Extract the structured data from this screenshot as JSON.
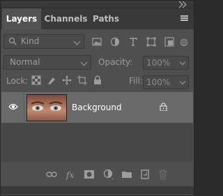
{
  "tabs": [
    {
      "label": "Layers",
      "active": true
    },
    {
      "label": "Channels",
      "active": false
    },
    {
      "label": "Paths",
      "active": false
    }
  ],
  "filter": {
    "label": "Kind",
    "icons": [
      "image-filter-icon",
      "adjustment-filter-icon",
      "type-filter-icon",
      "shape-filter-icon",
      "smart-object-filter-icon"
    ]
  },
  "blend": {
    "mode": "Normal",
    "opacity_label": "Opacity:",
    "opacity_value": "100%"
  },
  "lock": {
    "label": "Lock:",
    "fill_label": "Fill:",
    "fill_value": "100%"
  },
  "layers": [
    {
      "name": "Background",
      "visible": true,
      "locked": true
    }
  ],
  "bottom_icons": [
    "link-layers-icon",
    "fx-icon",
    "layer-mask-icon",
    "adjustment-layer-icon",
    "new-group-icon",
    "new-layer-icon",
    "trash-icon"
  ],
  "colors": {
    "panel": "#535353",
    "selected_row": "#6a6a6a"
  }
}
